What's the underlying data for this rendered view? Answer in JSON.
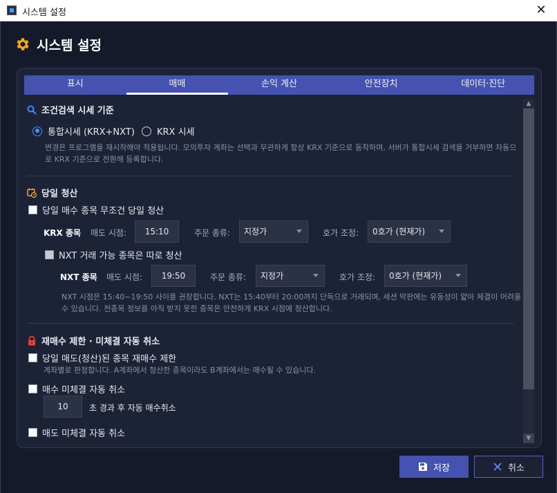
{
  "window": {
    "title": "시스템 설정"
  },
  "header": {
    "title": "시스템 설정"
  },
  "tabs": [
    {
      "label": "표시",
      "active": false
    },
    {
      "label": "매매",
      "active": true
    },
    {
      "label": "손익 계산",
      "active": false
    },
    {
      "label": "안전장치",
      "active": false
    },
    {
      "label": "데이터·진단",
      "active": false
    }
  ],
  "condition_search": {
    "title": "조건검색 시세 기준",
    "options": [
      {
        "label": "통합시세 (KRX+NXT)",
        "selected": true
      },
      {
        "label": "KRX 시세",
        "selected": false
      }
    ],
    "note": "변경은 프로그램을 재시작해야 적용됩니다. 모의투자 계좌는 선택과 무관하게 항상 KRX 기준으로 동작하며, 서버가 통합시세 검색을 거부하면 자동으로 KRX 기준으로 전환해 등록합니다."
  },
  "same_day": {
    "title": "당일 청산",
    "unconditional_label": "당일 매수 종목 무조건 당일 청산",
    "krx": {
      "label": "KRX 종목",
      "sell_time_label": "매도 시점:",
      "sell_time": "15:10",
      "order_type_label": "주문 종류:",
      "order_type": "지정가",
      "tick_adjust_label": "호가 조정:",
      "tick_adjust": "0호가 (현재가)"
    },
    "nxt_separate_label": "NXT 거래 가능 종목은 따로 청산",
    "nxt": {
      "label": "NXT 종목",
      "sell_time_label": "매도 시점:",
      "sell_time": "19:50",
      "order_type_label": "주문 종류:",
      "order_type": "지정가",
      "tick_adjust_label": "호가 조정:",
      "tick_adjust": "0호가 (현재가)"
    },
    "note": "NXT 시점은 15:40~19:50 사이를 권장합니다. NXT는 15:40부터 20:00까지 단독으로 거래되며, 세션 막판에는 유동성이 얇아 체결이 어려울 수 있습니다. 전종목 정보를 아직 받지 못한 종목은 안전하게 KRX 시점에 청산합니다."
  },
  "rebuy": {
    "title": "재매수 제한 · 미체결 자동 취소",
    "rebuy_label": "당일 매도(청산)된 종목 재매수 제한",
    "rebuy_note": "계좌별로 판정합니다. A계좌에서 청산한 종목이라도 B계좌에서는 매수될 수 있습니다.",
    "buy_cancel_label": "매수 미체결 자동 취소",
    "buy_cancel_seconds": "10",
    "buy_cancel_suffix": "초 경과 후 자동 매수취소",
    "sell_cancel_label": "매도 미체결 자동 취소"
  },
  "footer": {
    "save_label": "저장",
    "cancel_label": "취소"
  },
  "colors": {
    "accent": "#4552b0",
    "background": "#151a2a",
    "panel": "#1d2336",
    "gear": "#f5a623",
    "radio": "#4d8bff"
  }
}
